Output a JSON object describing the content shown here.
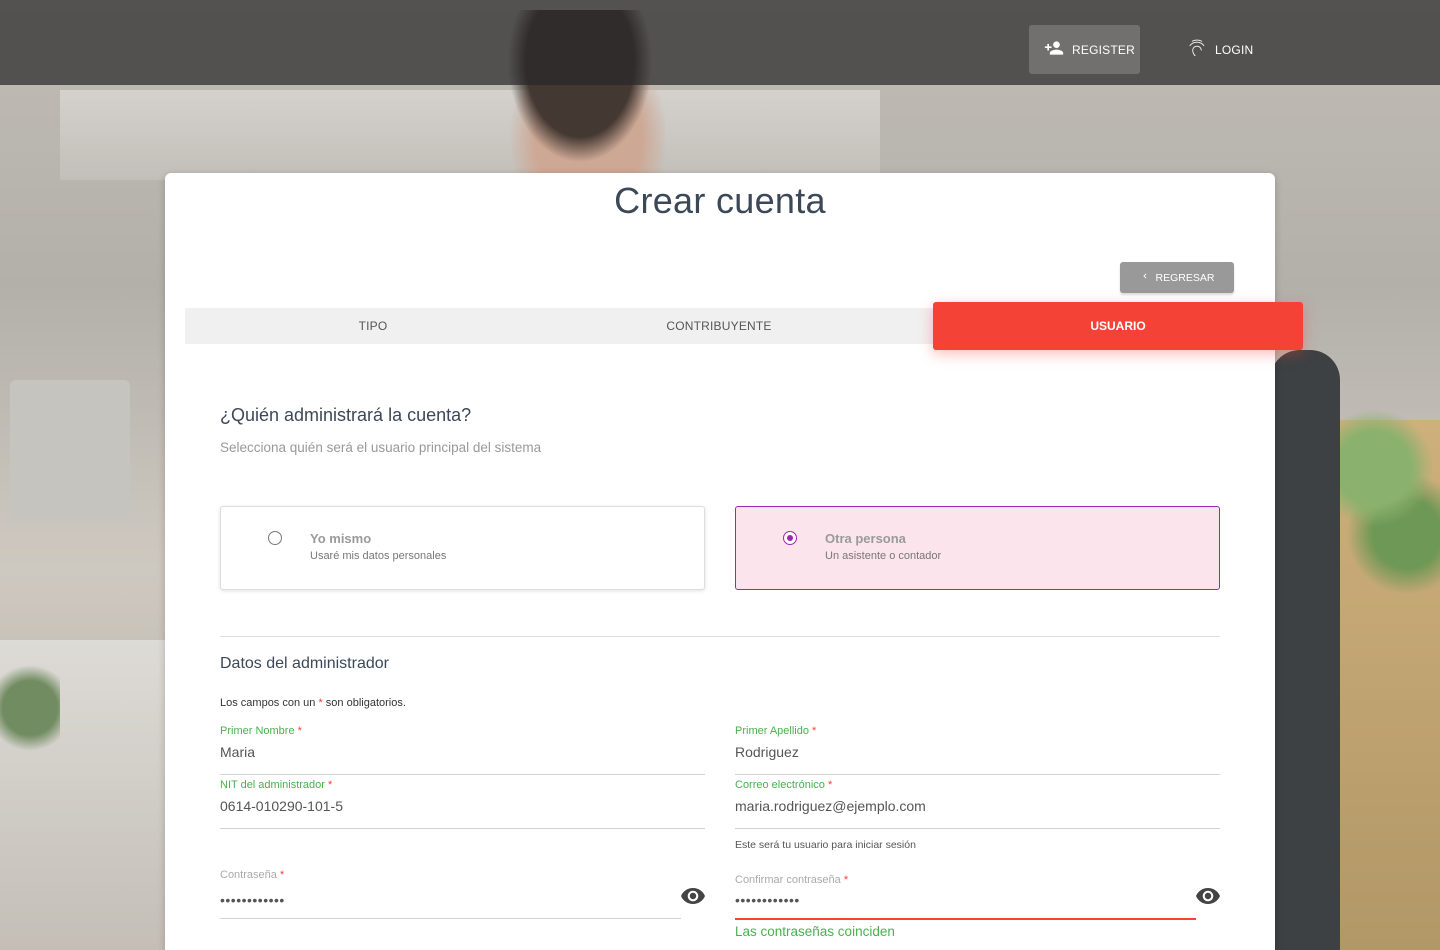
{
  "nav": {
    "register_label": "REGISTER",
    "login_label": "LOGIN",
    "register_icon": "person-add-icon",
    "login_icon": "fingerprint-icon"
  },
  "card": {
    "title": "Crear cuenta",
    "back_label": "REGRESAR"
  },
  "wizard": {
    "tabs": [
      {
        "label": "TIPO",
        "active": false
      },
      {
        "label": "CONTRIBUYENTE",
        "active": false
      },
      {
        "label": "USUARIO",
        "active": true
      }
    ],
    "active_color": "#f44336"
  },
  "question": {
    "title": "¿Quién administrará la cuenta?",
    "subtitle": "Selecciona quién será el usuario principal del sistema"
  },
  "options": [
    {
      "title": "Yo mismo",
      "desc": "Usaré mis datos personales",
      "selected": false
    },
    {
      "title": "Otra persona",
      "desc": "Un asistente o contador",
      "selected": true
    }
  ],
  "admin": {
    "title": "Datos del administrador",
    "required_note_prefix": "Los campos con un",
    "required_note_star": "*",
    "required_note_suffix": "son obligatorios."
  },
  "fields": {
    "first_name": {
      "label": "Primer Nombre",
      "value": "Maria"
    },
    "last_name": {
      "label": "Primer Apellido",
      "value": "Rodriguez"
    },
    "nit": {
      "label": "NIT del administrador",
      "value": "0614-010290-101-5"
    },
    "email": {
      "label": "Correo electrónico",
      "value": "maria.rodriguez@ejemplo.com",
      "hint": "Este será tu usuario para iniciar sesión"
    },
    "password": {
      "label": "Contraseña",
      "value": "••••••••••••"
    },
    "confirm": {
      "label": "Confirmar contraseña",
      "value": "••••••••••••",
      "message": "Las contraseñas coinciden"
    }
  },
  "colors": {
    "accent": "#f44336",
    "selected_border": "#9c27b0",
    "selected_bg": "#fce4ec",
    "label_green": "#4caf50"
  }
}
